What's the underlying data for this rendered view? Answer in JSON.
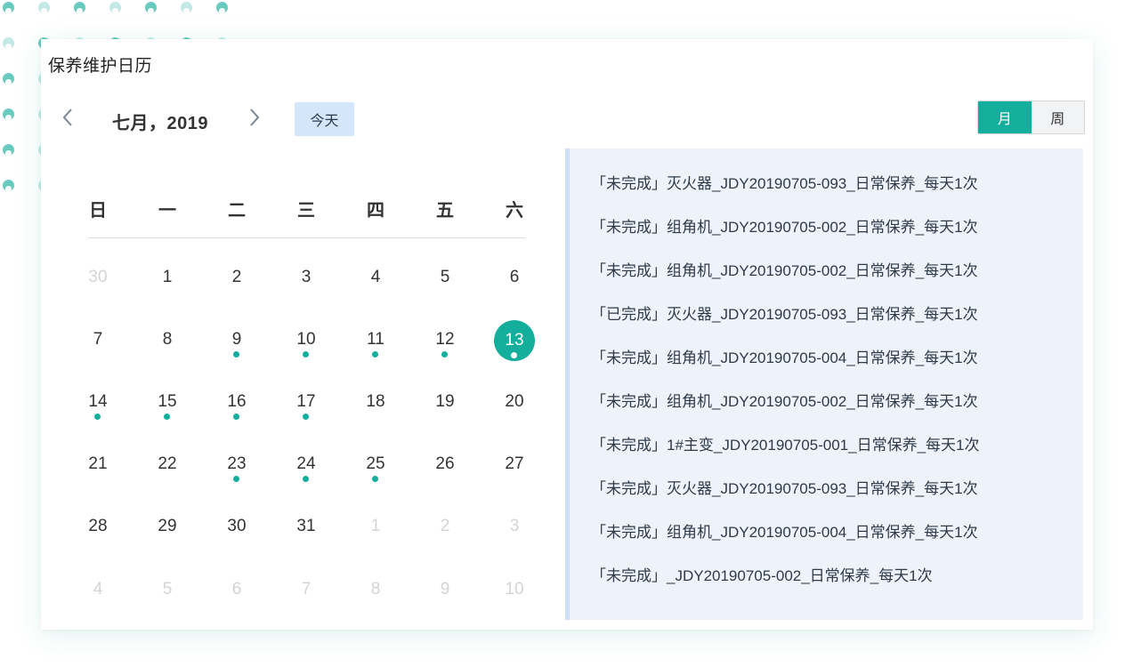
{
  "card": {
    "title": "保养维护日历"
  },
  "nav": {
    "month_label": "七月，2019",
    "today_label": "今天",
    "prev_icon": "chevron-left-icon",
    "next_icon": "chevron-right-icon"
  },
  "view_toggle": {
    "month_label": "月",
    "week_label": "周",
    "active": "月"
  },
  "weekdays": [
    "日",
    "一",
    "二",
    "三",
    "四",
    "五",
    "六"
  ],
  "weeks": [
    [
      {
        "d": "30",
        "muted": true
      },
      {
        "d": "1"
      },
      {
        "d": "2"
      },
      {
        "d": "3"
      },
      {
        "d": "4"
      },
      {
        "d": "5"
      },
      {
        "d": "6"
      }
    ],
    [
      {
        "d": "7"
      },
      {
        "d": "8"
      },
      {
        "d": "9",
        "dot": true
      },
      {
        "d": "10",
        "dot": true
      },
      {
        "d": "11",
        "dot": true
      },
      {
        "d": "12",
        "dot": true
      },
      {
        "d": "13",
        "dot": true,
        "selected": true
      }
    ],
    [
      {
        "d": "14",
        "dot": true
      },
      {
        "d": "15",
        "dot": true
      },
      {
        "d": "16",
        "dot": true
      },
      {
        "d": "17",
        "dot": true
      },
      {
        "d": "18"
      },
      {
        "d": "19"
      },
      {
        "d": "20"
      }
    ],
    [
      {
        "d": "21"
      },
      {
        "d": "22"
      },
      {
        "d": "23",
        "dot": true
      },
      {
        "d": "24",
        "dot": true
      },
      {
        "d": "25",
        "dot": true
      },
      {
        "d": "26"
      },
      {
        "d": "27"
      }
    ],
    [
      {
        "d": "28"
      },
      {
        "d": "29"
      },
      {
        "d": "30"
      },
      {
        "d": "31"
      },
      {
        "d": "1",
        "muted": true
      },
      {
        "d": "2",
        "muted": true
      },
      {
        "d": "3",
        "muted": true
      }
    ],
    [
      {
        "d": "4",
        "muted": true
      },
      {
        "d": "5",
        "muted": true
      },
      {
        "d": "6",
        "muted": true
      },
      {
        "d": "7",
        "muted": true
      },
      {
        "d": "8",
        "muted": true
      },
      {
        "d": "9",
        "muted": true
      },
      {
        "d": "10",
        "muted": true
      }
    ]
  ],
  "tasks": [
    "「未完成」灭火器_JDY20190705-093_日常保养_每天1次",
    "「未完成」组角机_JDY20190705-002_日常保养_每天1次",
    "「未完成」组角机_JDY20190705-002_日常保养_每天1次",
    "「已完成」灭火器_JDY20190705-093_日常保养_每天1次",
    "「未完成」组角机_JDY20190705-004_日常保养_每天1次",
    "「未完成」组角机_JDY20190705-002_日常保养_每天1次",
    "「未完成」1#主变_JDY20190705-001_日常保养_每天1次",
    "「未完成」灭火器_JDY20190705-093_日常保养_每天1次",
    "「未完成」组角机_JDY20190705-004_日常保养_每天1次",
    "「未完成」_JDY20190705-002_日常保养_每天1次"
  ],
  "colors": {
    "accent": "#14ae9c",
    "today_button_bg": "#d4e6fa",
    "panel_bg": "#eef2fb",
    "muted_text": "#d4d4d4"
  }
}
